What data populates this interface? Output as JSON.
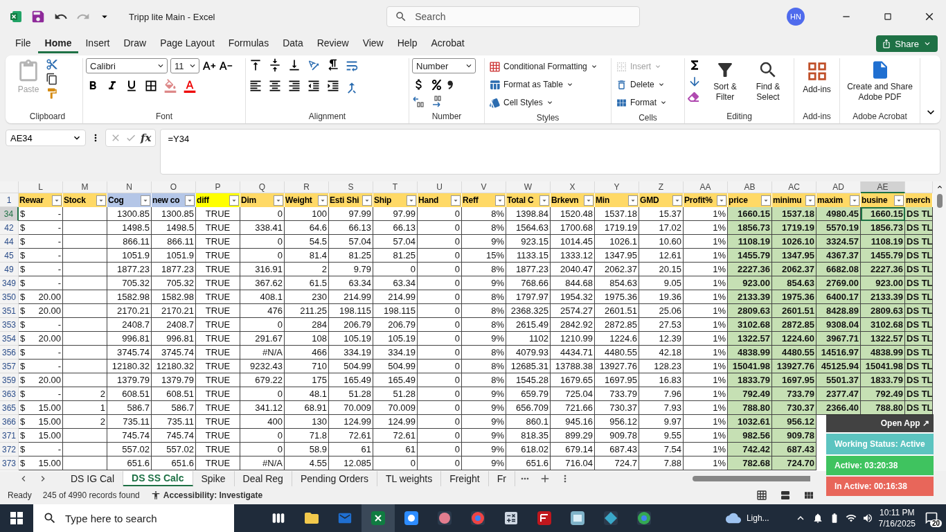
{
  "title_bar": {
    "title": "Tripp lite Main  -  Excel",
    "search": {
      "placeholder": "Search"
    },
    "avatar": "HN"
  },
  "menu_tabs": [
    {
      "label": "File",
      "selected": false
    },
    {
      "label": "Home",
      "selected": true
    },
    {
      "label": "Insert",
      "selected": false
    },
    {
      "label": "Draw",
      "selected": false
    },
    {
      "label": "Page Layout",
      "selected": false
    },
    {
      "label": "Formulas",
      "selected": false
    },
    {
      "label": "Data",
      "selected": false
    },
    {
      "label": "Review",
      "selected": false
    },
    {
      "label": "View",
      "selected": false
    },
    {
      "label": "Help",
      "selected": false
    },
    {
      "label": "Acrobat",
      "selected": false
    }
  ],
  "share_button": "Share",
  "ribbon": {
    "clipboard": {
      "label": "Clipboard",
      "paste": "Paste"
    },
    "font": {
      "label": "Font",
      "font_name": "Calibri",
      "font_size": "11"
    },
    "alignment": {
      "label": "Alignment"
    },
    "number": {
      "label": "Number",
      "format": "Number"
    },
    "styles": {
      "label": "Styles",
      "items": [
        "Conditional Formatting",
        "Format as Table",
        "Cell Styles"
      ]
    },
    "cells": {
      "label": "Cells",
      "items": [
        {
          "label": "Insert",
          "disabled": true
        },
        {
          "label": "Delete",
          "disabled": false
        },
        {
          "label": "Format",
          "disabled": false
        }
      ]
    },
    "editing": {
      "label": "Editing",
      "items": [
        "Sort & Filter",
        "Find & Select"
      ]
    },
    "addins": {
      "label": "Add-ins",
      "button": "Add-ins"
    },
    "acrobat": {
      "label": "Adobe Acrobat",
      "button": "Create and Share Adobe PDF"
    }
  },
  "formula_bar": {
    "name_box": "AE34",
    "fx_label": "fx",
    "formula": "=Y34"
  },
  "sheet": {
    "columns": [
      {
        "letter": "L",
        "header": "Rewar",
        "color": "#ffd966",
        "kind": "currency",
        "selected": false
      },
      {
        "letter": "M",
        "header": "Stock",
        "color": "#ffd966",
        "kind": "number",
        "selected": false
      },
      {
        "letter": "N",
        "header": "Cog",
        "color": "#b4c6e7",
        "kind": "number",
        "selected": false
      },
      {
        "letter": "O",
        "header": "new co",
        "color": "#b4c6e7",
        "kind": "number",
        "selected": false
      },
      {
        "letter": "P",
        "header": "diff",
        "color": "#ffff00",
        "kind": "center",
        "selected": false
      },
      {
        "letter": "Q",
        "header": "Dim",
        "color": "#ffd966",
        "kind": "number",
        "selected": false
      },
      {
        "letter": "R",
        "header": "Weight",
        "color": "#ffd966",
        "kind": "number",
        "selected": false
      },
      {
        "letter": "S",
        "header": "Esti Shi",
        "color": "#ffd966",
        "kind": "number",
        "selected": false
      },
      {
        "letter": "T",
        "header": "Ship",
        "color": "#ffd966",
        "kind": "number",
        "selected": false
      },
      {
        "letter": "U",
        "header": "Hand",
        "color": "#ffd966",
        "kind": "number",
        "selected": false
      },
      {
        "letter": "V",
        "header": "Reff",
        "color": "#ffd966",
        "kind": "number",
        "selected": false
      },
      {
        "letter": "W",
        "header": "Total C",
        "color": "#ffd966",
        "kind": "number",
        "selected": false
      },
      {
        "letter": "X",
        "header": "Brkevn",
        "color": "#ffd966",
        "kind": "number",
        "selected": false
      },
      {
        "letter": "Y",
        "header": "Min",
        "color": "#ffd966",
        "kind": "number",
        "selected": false
      },
      {
        "letter": "Z",
        "header": "GMD",
        "color": "#ffd966",
        "kind": "number",
        "selected": false
      },
      {
        "letter": "AA",
        "header": "Profit%",
        "color": "#ffd966",
        "kind": "number",
        "selected": false
      },
      {
        "letter": "AB",
        "header": "price",
        "color": "#ffd966",
        "kind": "highlight",
        "selected": false
      },
      {
        "letter": "AC",
        "header": "minimu",
        "color": "#ffd966",
        "kind": "highlight",
        "selected": false
      },
      {
        "letter": "AD",
        "header": "maxim",
        "color": "#ffd966",
        "kind": "highlight",
        "selected": false
      },
      {
        "letter": "AE",
        "header": "busine",
        "color": "#ffd966",
        "kind": "highlight",
        "selected": true
      },
      {
        "header": "merch",
        "color": "#ffd966",
        "kind": "label",
        "selected": false
      }
    ],
    "header_row": "1",
    "rows": [
      {
        "number": "34",
        "selected": true,
        "cells": [
          [
            "$",
            "-"
          ],
          null,
          "1300.85",
          "1300.85",
          "TRUE",
          "0",
          "100",
          "97.99",
          "97.99",
          "0",
          "8%",
          "1398.84",
          "1520.48",
          "1537.18",
          "15.37",
          "1%",
          "1660.15",
          "1537.18",
          "4980.45",
          "1660.15",
          "DS TL"
        ]
      },
      {
        "number": "42",
        "selected": false,
        "cells": [
          [
            "$",
            "-"
          ],
          null,
          "1498.5",
          "1498.5",
          "TRUE",
          "338.41",
          "64.6",
          "66.13",
          "66.13",
          "0",
          "8%",
          "1564.63",
          "1700.68",
          "1719.19",
          "17.02",
          "1%",
          "1856.73",
          "1719.19",
          "5570.19",
          "1856.73",
          "DS TL"
        ]
      },
      {
        "number": "44",
        "selected": false,
        "cells": [
          [
            "$",
            "-"
          ],
          null,
          "866.11",
          "866.11",
          "TRUE",
          "0",
          "54.5",
          "57.04",
          "57.04",
          "0",
          "9%",
          "923.15",
          "1014.45",
          "1026.1",
          "10.60",
          "1%",
          "1108.19",
          "1026.10",
          "3324.57",
          "1108.19",
          "DS TL"
        ]
      },
      {
        "number": "45",
        "selected": false,
        "cells": [
          [
            "$",
            "-"
          ],
          null,
          "1051.9",
          "1051.9",
          "TRUE",
          "0",
          "81.4",
          "81.25",
          "81.25",
          "0",
          "15%",
          "1133.15",
          "1333.12",
          "1347.95",
          "12.61",
          "1%",
          "1455.79",
          "1347.95",
          "4367.37",
          "1455.79",
          "DS TL"
        ]
      },
      {
        "number": "49",
        "selected": false,
        "cells": [
          [
            "$",
            "-"
          ],
          null,
          "1877.23",
          "1877.23",
          "TRUE",
          "316.91",
          "2",
          "9.79",
          "0",
          "0",
          "8%",
          "1877.23",
          "2040.47",
          "2062.37",
          "20.15",
          "1%",
          "2227.36",
          "2062.37",
          "6682.08",
          "2227.36",
          "DS TL"
        ]
      },
      {
        "number": "349",
        "selected": false,
        "cells": [
          [
            "$",
            "-"
          ],
          null,
          "705.32",
          "705.32",
          "TRUE",
          "367.62",
          "61.5",
          "63.34",
          "63.34",
          "0",
          "9%",
          "768.66",
          "844.68",
          "854.63",
          "9.05",
          "1%",
          "923.00",
          "854.63",
          "2769.00",
          "923.00",
          "DS TL"
        ]
      },
      {
        "number": "350",
        "selected": false,
        "cells": [
          [
            "$",
            "20.00"
          ],
          null,
          "1582.98",
          "1582.98",
          "TRUE",
          "408.1",
          "230",
          "214.99",
          "214.99",
          "0",
          "8%",
          "1797.97",
          "1954.32",
          "1975.36",
          "19.36",
          "1%",
          "2133.39",
          "1975.36",
          "6400.17",
          "2133.39",
          "DS TL"
        ]
      },
      {
        "number": "351",
        "selected": false,
        "cells": [
          [
            "$",
            "20.00"
          ],
          null,
          "2170.21",
          "2170.21",
          "TRUE",
          "476",
          "211.25",
          "198.115",
          "198.115",
          "0",
          "8%",
          "2368.325",
          "2574.27",
          "2601.51",
          "25.06",
          "1%",
          "2809.63",
          "2601.51",
          "8428.89",
          "2809.63",
          "DS TL"
        ]
      },
      {
        "number": "353",
        "selected": false,
        "cells": [
          [
            "$",
            "-"
          ],
          null,
          "2408.7",
          "2408.7",
          "TRUE",
          "0",
          "284",
          "206.79",
          "206.79",
          "0",
          "8%",
          "2615.49",
          "2842.92",
          "2872.85",
          "27.53",
          "1%",
          "3102.68",
          "2872.85",
          "9308.04",
          "3102.68",
          "DS TL"
        ]
      },
      {
        "number": "354",
        "selected": false,
        "cells": [
          [
            "$",
            "20.00"
          ],
          null,
          "996.81",
          "996.81",
          "TRUE",
          "291.67",
          "108",
          "105.19",
          "105.19",
          "0",
          "9%",
          "1102",
          "1210.99",
          "1224.6",
          "12.39",
          "1%",
          "1322.57",
          "1224.60",
          "3967.71",
          "1322.57",
          "DS TL"
        ]
      },
      {
        "number": "356",
        "selected": false,
        "cells": [
          [
            "$",
            "-"
          ],
          null,
          "3745.74",
          "3745.74",
          "TRUE",
          "#N/A",
          "466",
          "334.19",
          "334.19",
          "0",
          "8%",
          "4079.93",
          "4434.71",
          "4480.55",
          "42.18",
          "1%",
          "4838.99",
          "4480.55",
          "14516.97",
          "4838.99",
          "DS TL"
        ]
      },
      {
        "number": "357",
        "selected": false,
        "cells": [
          [
            "$",
            "-"
          ],
          null,
          "12180.32",
          "12180.32",
          "TRUE",
          "9232.43",
          "710",
          "504.99",
          "504.99",
          "0",
          "8%",
          "12685.31",
          "13788.38",
          "13927.76",
          "128.23",
          "1%",
          "15041.98",
          "13927.76",
          "45125.94",
          "15041.98",
          "DS TL"
        ]
      },
      {
        "number": "359",
        "selected": false,
        "cells": [
          [
            "$",
            "20.00"
          ],
          null,
          "1379.79",
          "1379.79",
          "TRUE",
          "679.22",
          "175",
          "165.49",
          "165.49",
          "0",
          "8%",
          "1545.28",
          "1679.65",
          "1697.95",
          "16.83",
          "1%",
          "1833.79",
          "1697.95",
          "5501.37",
          "1833.79",
          "DS TL"
        ]
      },
      {
        "number": "363",
        "selected": false,
        "cells": [
          [
            "$",
            "-"
          ],
          "2",
          "608.51",
          "608.51",
          "TRUE",
          "0",
          "48.1",
          "51.28",
          "51.28",
          "0",
          "9%",
          "659.79",
          "725.04",
          "733.79",
          "7.96",
          "1%",
          "792.49",
          "733.79",
          "2377.47",
          "792.49",
          "DS TL"
        ]
      },
      {
        "number": "365",
        "selected": false,
        "cells": [
          [
            "$",
            "15.00"
          ],
          "1",
          "586.7",
          "586.7",
          "TRUE",
          "341.12",
          "68.91",
          "70.009",
          "70.009",
          "0",
          "9%",
          "656.709",
          "721.66",
          "730.37",
          "7.93",
          "1%",
          "788.80",
          "730.37",
          "2366.40",
          "788.80",
          "DS TL"
        ]
      },
      {
        "number": "366",
        "selected": false,
        "cells": [
          [
            "$",
            "15.00"
          ],
          "2",
          "735.11",
          "735.11",
          "TRUE",
          "400",
          "130",
          "124.99",
          "124.99",
          "0",
          "9%",
          "860.1",
          "945.16",
          "956.12",
          "9.97",
          "1%",
          "1032.61",
          "956.12"
        ]
      },
      {
        "number": "371",
        "selected": false,
        "cells": [
          [
            "$",
            "15.00"
          ],
          null,
          "745.74",
          "745.74",
          "TRUE",
          "0",
          "71.8",
          "72.61",
          "72.61",
          "0",
          "9%",
          "818.35",
          "899.29",
          "909.78",
          "9.55",
          "1%",
          "982.56",
          "909.78"
        ]
      },
      {
        "number": "372",
        "selected": false,
        "cells": [
          [
            "$",
            "-"
          ],
          null,
          "557.02",
          "557.02",
          "TRUE",
          "0",
          "58.9",
          "61",
          "61",
          "0",
          "9%",
          "618.02",
          "679.14",
          "687.43",
          "7.54",
          "1%",
          "742.42",
          "687.43"
        ]
      },
      {
        "number": "373",
        "selected": false,
        "cells": [
          [
            "$",
            "15.00"
          ],
          null,
          "651.6",
          "651.6",
          "TRUE",
          "#N/A",
          "4.55",
          "12.085",
          "0",
          "0",
          "9%",
          "651.6",
          "716.04",
          "724.7",
          "7.88",
          "1%",
          "782.68",
          "724.70"
        ]
      }
    ]
  },
  "sheet_tabs": [
    {
      "label": "DS IG Cal",
      "selected": false
    },
    {
      "label": "DS SS Calc",
      "selected": true
    },
    {
      "label": "Spike",
      "selected": false
    },
    {
      "label": "Deal Reg",
      "selected": false
    },
    {
      "label": "Pending Orders",
      "selected": false
    },
    {
      "label": "TL weights",
      "selected": false
    },
    {
      "label": "Freight",
      "selected": false
    },
    {
      "label": "Fr",
      "selected": false
    }
  ],
  "status_bar": {
    "mode": "Ready",
    "records": "245 of 4990 records found",
    "accessibility": "Accessibility: Investigate"
  },
  "widget": {
    "open_app": "Open App ↗",
    "status": "Working Status: Active",
    "active": "Active: 03:20:38",
    "inactive": "In Active: 00:16:38"
  },
  "taskbar": {
    "search_placeholder": "Type here to search",
    "weather": "Ligh...",
    "time": "10:11 PM",
    "date": "7/16/2025",
    "notifications": "20"
  }
}
